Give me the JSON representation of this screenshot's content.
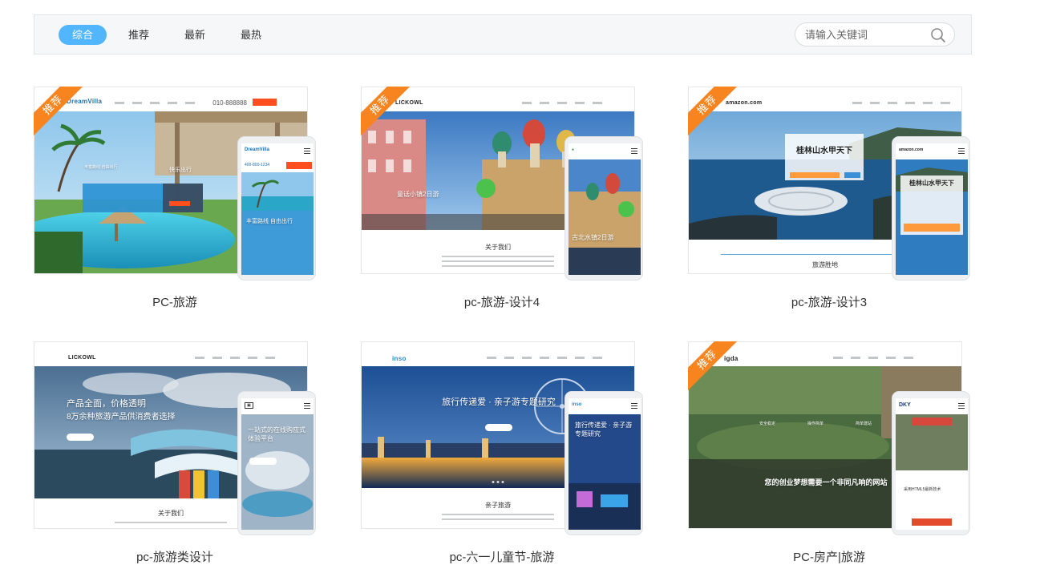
{
  "filter": {
    "tabs": [
      {
        "label": "综合",
        "active": true
      },
      {
        "label": "推荐",
        "active": false
      },
      {
        "label": "最新",
        "active": false
      },
      {
        "label": "最热",
        "active": false
      }
    ],
    "search": {
      "placeholder": "请输入关键词",
      "icon": "search-icon"
    }
  },
  "colors": {
    "accent": "#52b6ff",
    "ribbon": "#f7841e",
    "red": "#ff4f1f",
    "green": "#4cc24c"
  },
  "ribbon_label": "推荐",
  "cards": [
    {
      "title": "PC-旅游",
      "brand": "DreamVilla",
      "phone_brand": "DreamVilla",
      "contact": "010-888888",
      "hero_text": "丰富路线 自由出行",
      "hero_button": "快乐出行",
      "phone_contact": "400-800-1234",
      "phone_text": "丰富路线 自由出行"
    },
    {
      "title": "pc-旅游-设计4",
      "brand": "LICKOWL",
      "hero_text": "童话小镇2日游",
      "section_title": "关于我们",
      "phone_text": "古北水镇2日游"
    },
    {
      "title": "pc-旅游-设计3",
      "brand": "amazon.com",
      "phone_brand": "amazon.com",
      "hero_text": "桂林山水甲天下",
      "section_title": "旅游胜地",
      "phone_text": "桂林山水甲天下"
    },
    {
      "title": "pc-旅游类设计",
      "brand": "LICKOWL",
      "hero_text": "产品全面，价格透明",
      "hero_text2": "8万余种旅游产品供消费者选择",
      "section_title": "关于我们",
      "phone_text": "一站式的在线购应式体验平台"
    },
    {
      "title": "pc-六一儿童节-旅游",
      "brand": "inso",
      "phone_brand": "inso",
      "hero_text": "旅行传递爱 · 亲子游专题研究",
      "section_title": "亲子旅游",
      "phone_text": "旅行传递爱 · 亲子游专题研究"
    },
    {
      "title": "PC-房产|旅游",
      "brand": "igda",
      "phone_brand": "DKY",
      "hero_text": "您的创业梦想需要一个非同凡响的网站",
      "feature1": "安全稳定",
      "feature2": "操作简单",
      "feature3": "简单建站",
      "phone_text": "采用HTML5最新技术"
    }
  ]
}
